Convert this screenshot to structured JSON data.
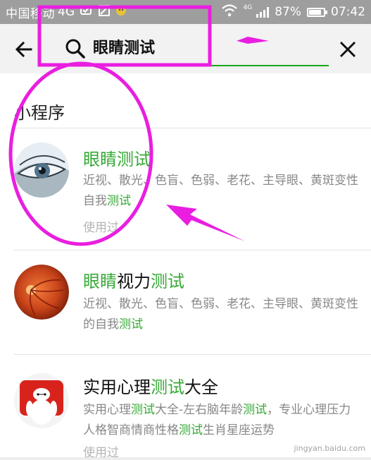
{
  "status_bar": {
    "carrier": "中国移动",
    "network": "4G",
    "network_badge": "4G",
    "battery": "87%",
    "battery_level": 0.87,
    "time": "07:42"
  },
  "search": {
    "query": "眼睛测试"
  },
  "section": {
    "title": "小程序"
  },
  "results": [
    {
      "title_parts": [
        {
          "text": "眼睛测试",
          "hl": true
        }
      ],
      "desc_parts": [
        {
          "text": "近视、散光、色盲、色弱、老花、主导眼、黄斑变性自我",
          "hl": false
        },
        {
          "text": "测试",
          "hl": true
        }
      ],
      "meta": "使用过",
      "avatar_icon": "eye-photo-icon"
    },
    {
      "title_parts": [
        {
          "text": "眼睛",
          "hl": true
        },
        {
          "text": "视力",
          "hl": false
        },
        {
          "text": "测试",
          "hl": true
        }
      ],
      "desc_parts": [
        {
          "text": "近视、散光、色盲、色弱、老花、主导眼、黄斑变性的自我",
          "hl": false
        },
        {
          "text": "测试",
          "hl": true
        }
      ],
      "meta": "",
      "avatar_icon": "retina-icon"
    },
    {
      "title_parts": [
        {
          "text": "实用心理",
          "hl": false
        },
        {
          "text": "测试",
          "hl": true
        },
        {
          "text": "大全",
          "hl": false
        }
      ],
      "desc_parts": [
        {
          "text": "实用心理",
          "hl": false
        },
        {
          "text": "测试",
          "hl": true
        },
        {
          "text": "大全-左右脑年龄",
          "hl": false
        },
        {
          "text": "测试",
          "hl": true
        },
        {
          "text": "，专业心理压力人格智商情商性格",
          "hl": false
        },
        {
          "text": "测试",
          "hl": true
        },
        {
          "text": "生肖星座运势",
          "hl": false
        }
      ],
      "meta": "使用过",
      "avatar_icon": "robot-mascot-icon"
    }
  ],
  "watermark": "jingyan.baidu.com",
  "colors": {
    "highlight": "#35a935",
    "accent_underline": "#19a619",
    "annotation": "#e91ee0"
  }
}
